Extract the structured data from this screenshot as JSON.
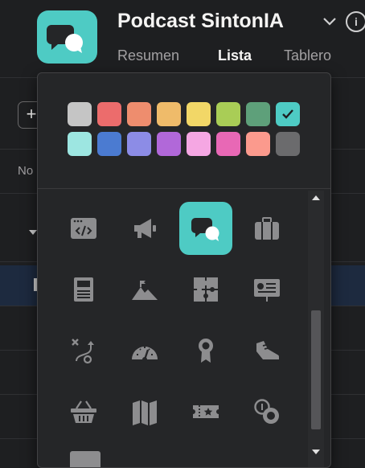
{
  "project": {
    "title": "Podcast SintonIA",
    "icon": "chat-bubbles-icon",
    "accent_color": "#4ecbc4"
  },
  "tabs": [
    {
      "label": "Resumen",
      "active": false
    },
    {
      "label": "Lista",
      "active": true
    },
    {
      "label": "Tablero",
      "active": false
    }
  ],
  "toolbar": {
    "add_label": "+"
  },
  "list": {
    "column_header": "No"
  },
  "color_picker": {
    "swatches": [
      {
        "color": "#c5c5c5",
        "selected": false
      },
      {
        "color": "#ec6c6c",
        "selected": false
      },
      {
        "color": "#ee8d6e",
        "selected": false
      },
      {
        "color": "#efbb6a",
        "selected": false
      },
      {
        "color": "#f2d767",
        "selected": false
      },
      {
        "color": "#a9cd56",
        "selected": false
      },
      {
        "color": "#5ea07a",
        "selected": false
      },
      {
        "color": "#4ecbc4",
        "selected": true
      },
      {
        "color": "#9de6e1",
        "selected": false
      },
      {
        "color": "#4b7bd1",
        "selected": false
      },
      {
        "color": "#8c8ce6",
        "selected": false
      },
      {
        "color": "#b168d9",
        "selected": false
      },
      {
        "color": "#f5a7e3",
        "selected": false
      },
      {
        "color": "#e868b5",
        "selected": false
      },
      {
        "color": "#fb9a8d",
        "selected": false
      },
      {
        "color": "#6b6b6d",
        "selected": false
      }
    ]
  },
  "icon_picker": {
    "icons": [
      {
        "name": "code-window-icon",
        "selected": false
      },
      {
        "name": "megaphone-icon",
        "selected": false
      },
      {
        "name": "chat-bubbles-icon",
        "selected": true
      },
      {
        "name": "briefcase-icon",
        "selected": false
      },
      {
        "name": "newspaper-icon",
        "selected": false
      },
      {
        "name": "mountain-flag-icon",
        "selected": false
      },
      {
        "name": "puzzle-icon",
        "selected": false
      },
      {
        "name": "presentation-icon",
        "selected": false
      },
      {
        "name": "strategy-path-icon",
        "selected": false
      },
      {
        "name": "speedometer-icon",
        "selected": false
      },
      {
        "name": "award-ribbon-icon",
        "selected": false
      },
      {
        "name": "sneaker-icon",
        "selected": false
      },
      {
        "name": "shopping-basket-icon",
        "selected": false
      },
      {
        "name": "map-icon",
        "selected": false
      },
      {
        "name": "ticket-icon",
        "selected": false
      },
      {
        "name": "coins-icon",
        "selected": false
      }
    ]
  }
}
